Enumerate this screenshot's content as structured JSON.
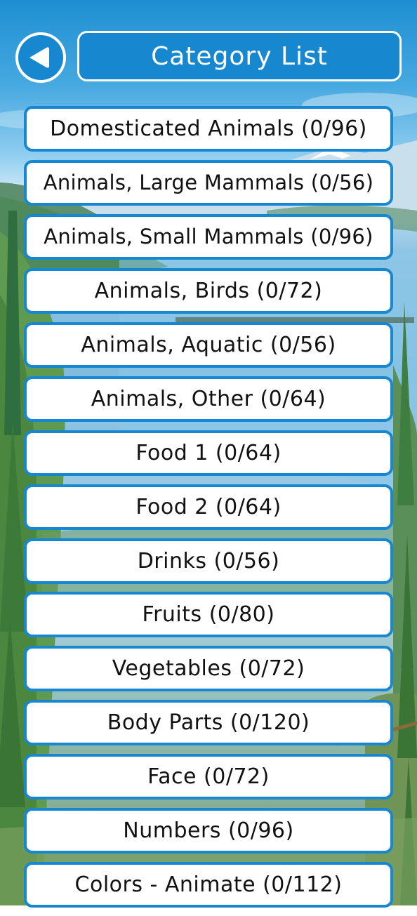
{
  "header": {
    "title": "Category List",
    "back_icon": "back-arrow-icon"
  },
  "colors": {
    "button_blue": "#1787cf",
    "item_bg": "#ffffff",
    "text": "#111111"
  },
  "categories": [
    {
      "label": "Domesticated Animals (0/96)"
    },
    {
      "label": "Animals, Large Mammals (0/56)"
    },
    {
      "label": "Animals, Small Mammals (0/96)"
    },
    {
      "label": "Animals, Birds (0/72)"
    },
    {
      "label": "Animals, Aquatic (0/56)"
    },
    {
      "label": "Animals, Other (0/64)"
    },
    {
      "label": "Food 1 (0/64)"
    },
    {
      "label": "Food 2 (0/64)"
    },
    {
      "label": "Drinks (0/56)"
    },
    {
      "label": "Fruits (0/80)"
    },
    {
      "label": "Vegetables (0/72)"
    },
    {
      "label": "Body Parts (0/120)"
    },
    {
      "label": "Face (0/72)"
    },
    {
      "label": "Numbers (0/96)"
    },
    {
      "label": "Colors - Animate (0/112)"
    }
  ]
}
